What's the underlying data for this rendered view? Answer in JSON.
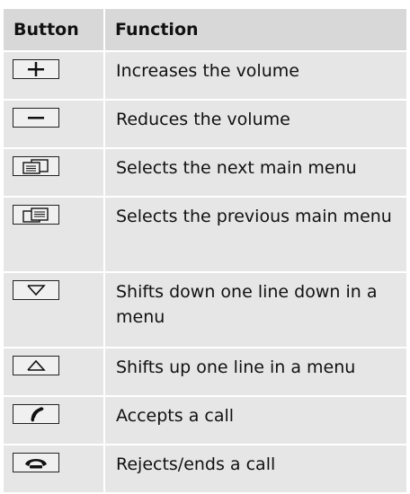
{
  "table": {
    "header": {
      "button": "Button",
      "function": "Function"
    },
    "rows": [
      {
        "icon": "plus-icon",
        "function": "Increases the volume"
      },
      {
        "icon": "minus-icon",
        "function": "Reduces the volume"
      },
      {
        "icon": "next-menu-icon",
        "function": "Selects the next main menu"
      },
      {
        "icon": "previous-menu-icon",
        "function": "Selects the previous main menu"
      },
      {
        "icon": "down-arrow-icon",
        "function": "Shifts down one line down in a menu"
      },
      {
        "icon": "up-arrow-icon",
        "function": "Shifts up one line in a menu"
      },
      {
        "icon": "accept-call-icon",
        "function": "Accepts a call"
      },
      {
        "icon": "reject-call-icon",
        "function": "Rejects/ends a call"
      }
    ]
  }
}
